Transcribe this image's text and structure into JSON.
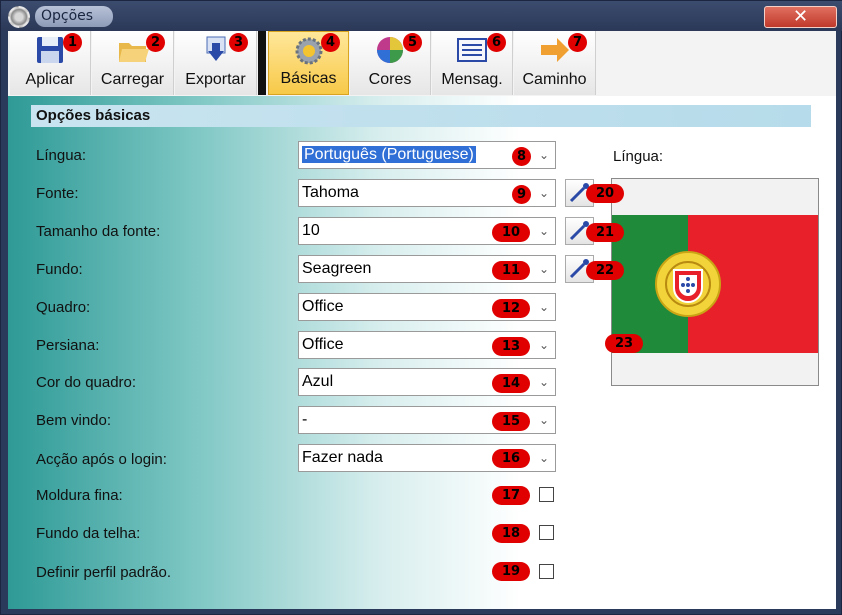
{
  "window": {
    "title": "Opções",
    "close_glyph": "✕"
  },
  "toolbar": {
    "buttons": [
      {
        "label": "Aplicar",
        "badge": "1",
        "icon": "floppy-disk-icon"
      },
      {
        "label": "Carregar",
        "badge": "2",
        "icon": "open-folder-icon"
      },
      {
        "label": "Exportar",
        "badge": "3",
        "icon": "export-icon"
      },
      {
        "label": "Básicas",
        "badge": "4",
        "icon": "gear-icon",
        "active": true
      },
      {
        "label": "Cores",
        "badge": "5",
        "icon": "color-wheel-icon"
      },
      {
        "label": "Mensag.",
        "badge": "6",
        "icon": "message-icon"
      },
      {
        "label": "Caminho",
        "badge": "7",
        "icon": "arrow-right-icon"
      }
    ]
  },
  "section": {
    "title": "Opções básicas"
  },
  "fields": [
    {
      "label": "Língua:",
      "value": "Português (Portuguese)",
      "badge": "8"
    },
    {
      "label": "Fonte:",
      "value": "Tahoma",
      "badge": "9"
    },
    {
      "label": "Tamanho da fonte:",
      "value": "10",
      "badge": "10"
    },
    {
      "label": "Fundo:",
      "value": "Seagreen",
      "badge": "11"
    },
    {
      "label": "Quadro:",
      "value": "Office",
      "badge": "12"
    },
    {
      "label": "Persiana:",
      "value": "Office",
      "badge": "13"
    },
    {
      "label": "Cor do quadro:",
      "value": "Azul",
      "badge": "14"
    },
    {
      "label": "Bem vindo:",
      "value": "-",
      "badge": "15"
    },
    {
      "label": "Acção após o login:",
      "value": "Fazer nada",
      "badge": "16"
    }
  ],
  "checkboxes": [
    {
      "label": "Moldura fina:",
      "badge": "17",
      "checked": false
    },
    {
      "label": "Fundo da telha:",
      "badge": "18",
      "checked": false
    },
    {
      "label": "Definir perfil padrão.",
      "badge": "19",
      "checked": false
    }
  ],
  "pickers": [
    {
      "badge": "20",
      "icon": "eyedropper-icon"
    },
    {
      "badge": "21",
      "icon": "eyedropper-icon"
    },
    {
      "badge": "22",
      "icon": "eyedropper-icon"
    }
  ],
  "preview": {
    "label": "Língua:",
    "badge": "23",
    "flag": "portugal-flag"
  },
  "colors": {
    "accent_badge": "#e00000",
    "selection": "#2f6fd6",
    "active_tab": "#f7c948"
  }
}
